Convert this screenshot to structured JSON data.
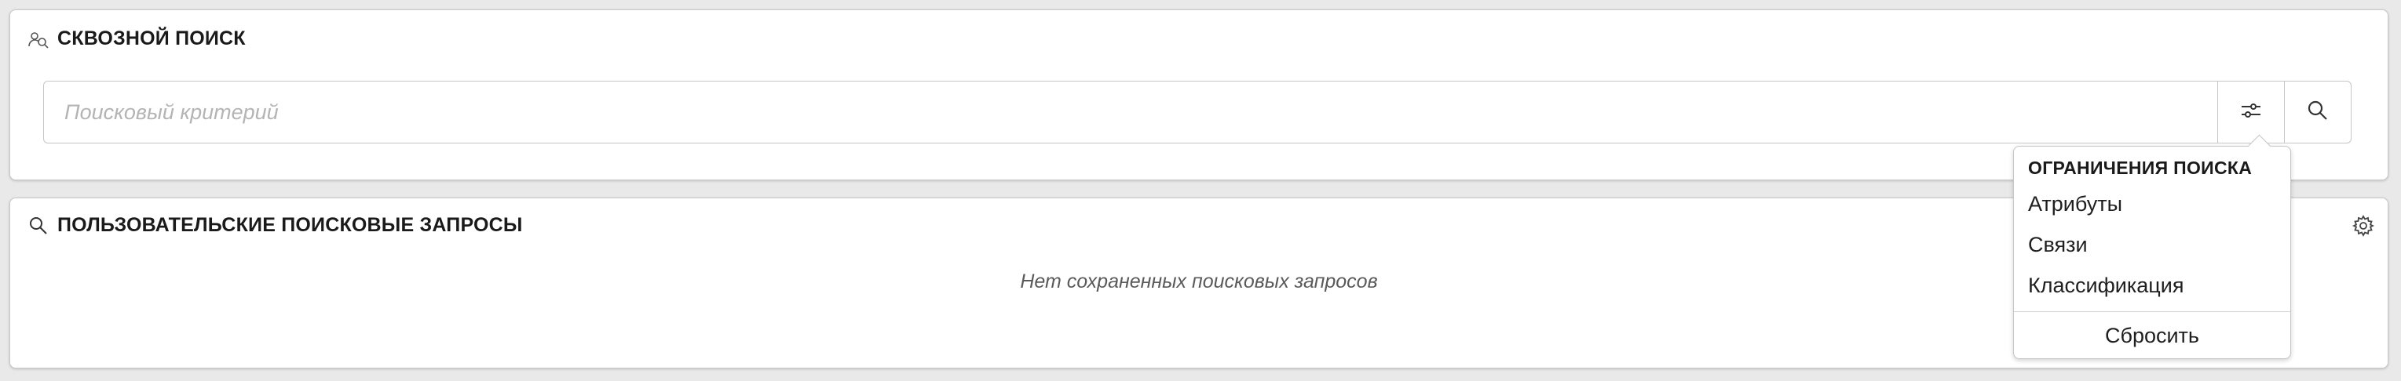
{
  "global_search": {
    "title": "СКВОЗНОЙ ПОИСК",
    "header_icon": "person-search-icon",
    "search": {
      "placeholder": "Поисковый критерий",
      "value": "",
      "filter_icon": "sliders-icon",
      "search_icon": "magnifier-icon"
    }
  },
  "user_queries": {
    "title": "ПОЛЬЗОВАТЕЛЬСКИЕ ПОИСКОВЫЕ ЗАПРОСЫ",
    "header_icon": "magnifier-icon",
    "empty_text": "Нет сохраненных поисковых запросов",
    "settings_icon": "gear-icon"
  },
  "restrictions_menu": {
    "title": "ОГРАНИЧЕНИЯ ПОИСКА",
    "items": [
      "Атрибуты",
      "Связи",
      "Классификация"
    ],
    "reset_label": "Сбросить"
  },
  "colors": {
    "background": "#e9e9e9",
    "panel": "#ffffff",
    "border": "#c6c6c6",
    "placeholder": "#b4b4b4"
  }
}
